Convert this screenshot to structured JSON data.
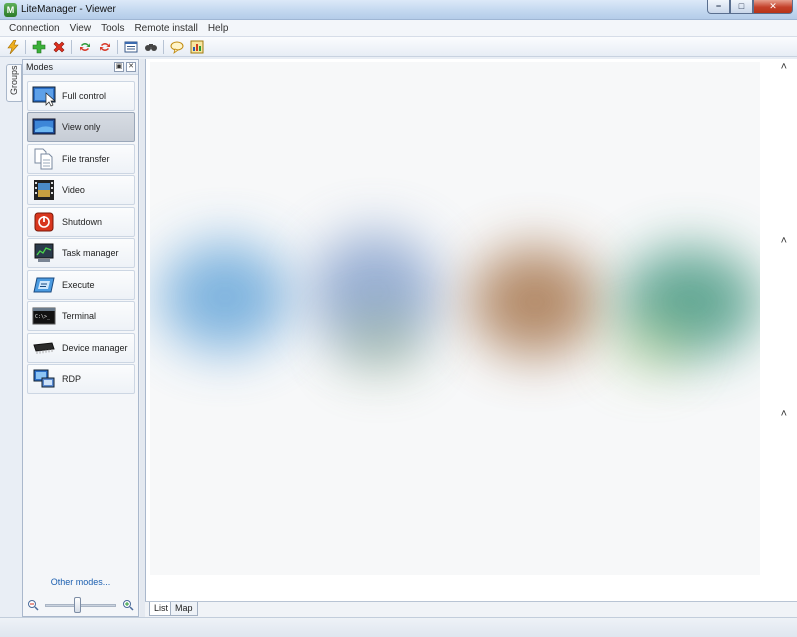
{
  "window": {
    "title": "LiteManager - Viewer",
    "app_icon_letter": "M"
  },
  "menu": [
    {
      "label": "Connection"
    },
    {
      "label": "View"
    },
    {
      "label": "Tools"
    },
    {
      "label": "Remote install"
    },
    {
      "label": "Help"
    }
  ],
  "toolbar": [
    "lightning-icon",
    "add-icon",
    "delete-icon",
    "refresh-icon",
    "reconnect-icon",
    "list-view-icon",
    "find-icon",
    "chat-icon",
    "stats-icon"
  ],
  "groups_tab": {
    "label": "Groups"
  },
  "modes_panel": {
    "title": "Modes",
    "pin_glyph": "▣",
    "close_glyph": "✕",
    "items": [
      {
        "label": "Full control",
        "icon": "full-control-icon"
      },
      {
        "label": "View only",
        "icon": "view-only-icon",
        "active": true
      },
      {
        "label": "File transfer",
        "icon": "file-transfer-icon"
      },
      {
        "label": "Video",
        "icon": "video-icon"
      },
      {
        "label": "Shutdown",
        "icon": "shutdown-icon"
      },
      {
        "label": "Task manager",
        "icon": "task-manager-icon"
      },
      {
        "label": "Execute",
        "icon": "execute-icon"
      },
      {
        "label": "Terminal",
        "icon": "terminal-icon"
      },
      {
        "label": "Device manager",
        "icon": "device-manager-icon"
      },
      {
        "label": "RDP",
        "icon": "rdp-icon"
      }
    ],
    "other_modes": "Other modes...",
    "zoom_level": 0.45
  },
  "bottom_tabs": [
    {
      "label": "List",
      "active": true
    },
    {
      "label": "Map"
    }
  ],
  "window_controls": {
    "minimize": "−",
    "maximize": "□",
    "close": "✕"
  },
  "scroll_glyph": "˄"
}
